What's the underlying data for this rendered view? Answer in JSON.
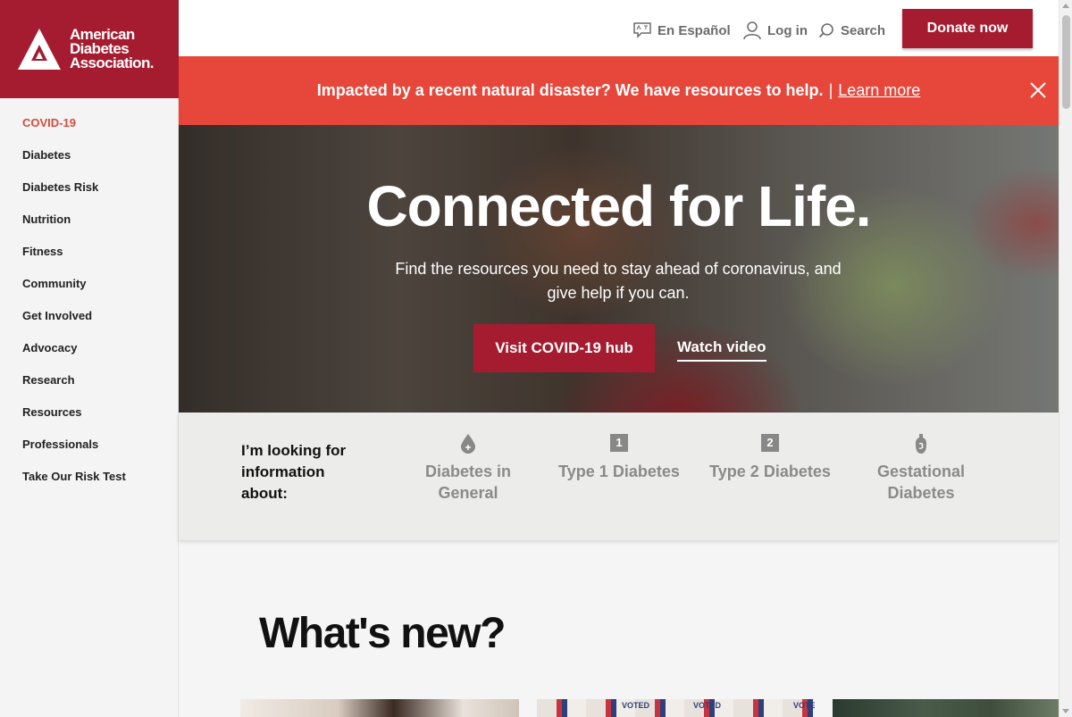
{
  "brand": {
    "name_lines": [
      "American",
      "Diabetes",
      "Association."
    ],
    "color": "#a51c30"
  },
  "sidebar": {
    "items": [
      {
        "label": "COVID-19",
        "active": true
      },
      {
        "label": "Diabetes"
      },
      {
        "label": "Diabetes Risk"
      },
      {
        "label": "Nutrition"
      },
      {
        "label": "Fitness"
      },
      {
        "label": "Community"
      },
      {
        "label": "Get Involved"
      },
      {
        "label": "Advocacy"
      },
      {
        "label": "Research"
      },
      {
        "label": "Resources"
      },
      {
        "label": "Professionals"
      },
      {
        "label": "Take Our Risk Test"
      }
    ]
  },
  "topbar": {
    "language": {
      "label": "En Español",
      "icon": "translate-icon"
    },
    "login": {
      "label": "Log in",
      "icon": "user-icon"
    },
    "search": {
      "label": "Search",
      "icon": "search-icon"
    },
    "donate_label": "Donate now"
  },
  "alert": {
    "message": "Impacted by a recent natural disaster? We have resources to help.",
    "separator": "|",
    "link_label": "Learn more",
    "background": "#e7473a"
  },
  "hero": {
    "title": "Connected for Life.",
    "subtitle": "Find the resources you need to stay ahead of coronavirus, and give help if you can.",
    "primary_button": "Visit COVID-19 hub",
    "secondary_link": "Watch video"
  },
  "info": {
    "label": "I’m looking for information about:",
    "topics": [
      {
        "label": "Diabetes in General",
        "icon": "drop-icon"
      },
      {
        "label": "Type 1 Diabetes",
        "icon": "type1-icon",
        "badge": "1"
      },
      {
        "label": "Type 2 Diabetes",
        "icon": "type2-icon",
        "badge": "2"
      },
      {
        "label": "Gestational Diabetes",
        "icon": "gestational-icon"
      }
    ]
  },
  "whats_new": {
    "title": "What's new?",
    "card2_stickers": [
      "VOTED",
      "VOTED",
      "VOTE"
    ]
  }
}
